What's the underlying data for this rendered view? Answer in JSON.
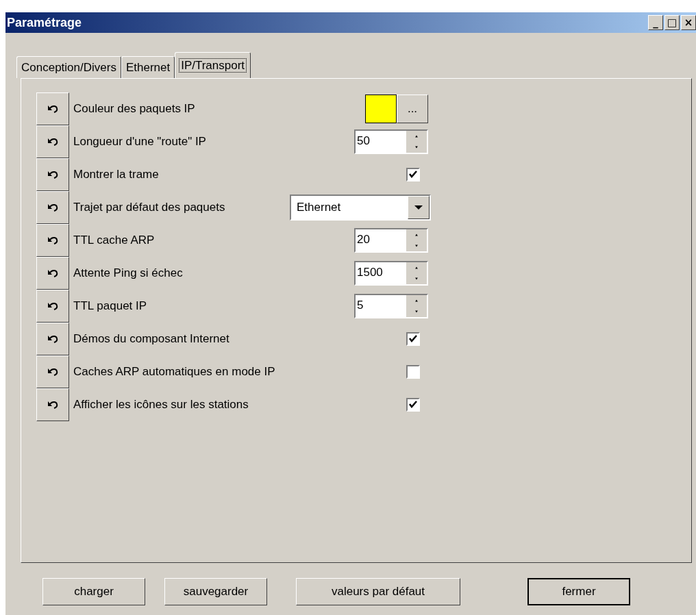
{
  "window": {
    "title": "Paramétrage",
    "controls": [
      "_",
      "□",
      "×"
    ]
  },
  "tabs": [
    {
      "label": "Conception/Divers",
      "selected": false
    },
    {
      "label": "Ethernet",
      "selected": false
    },
    {
      "label": "IP/Transport",
      "selected": true
    }
  ],
  "settings": [
    {
      "kind": "color",
      "label": "Couleur des paquets IP",
      "color": "#ffff00",
      "button": "..."
    },
    {
      "kind": "spin",
      "label": "Longueur d'une \"route\" IP",
      "value": "50"
    },
    {
      "kind": "check",
      "label": "Montrer la trame",
      "checked": true
    },
    {
      "kind": "select",
      "label": "Trajet par défaut des paquets",
      "value": "Ethernet"
    },
    {
      "kind": "spin",
      "label": "TTL cache ARP",
      "value": "20"
    },
    {
      "kind": "spin",
      "label": "Attente Ping si échec",
      "value": "1500"
    },
    {
      "kind": "spin",
      "label": "TTL paquet IP",
      "value": "5"
    },
    {
      "kind": "check",
      "label": "Démos du composant Internet",
      "checked": true
    },
    {
      "kind": "check",
      "label": "Caches ARP automatiques en mode IP",
      "checked": false
    },
    {
      "kind": "check",
      "label": "Afficher les icônes sur les stations",
      "checked": true
    }
  ],
  "buttons": [
    {
      "label": "charger",
      "default": false
    },
    {
      "label": "sauvegarder",
      "default": false
    },
    {
      "label": "valeurs par défaut",
      "default": false
    },
    {
      "label": "fermer",
      "default": true
    }
  ]
}
